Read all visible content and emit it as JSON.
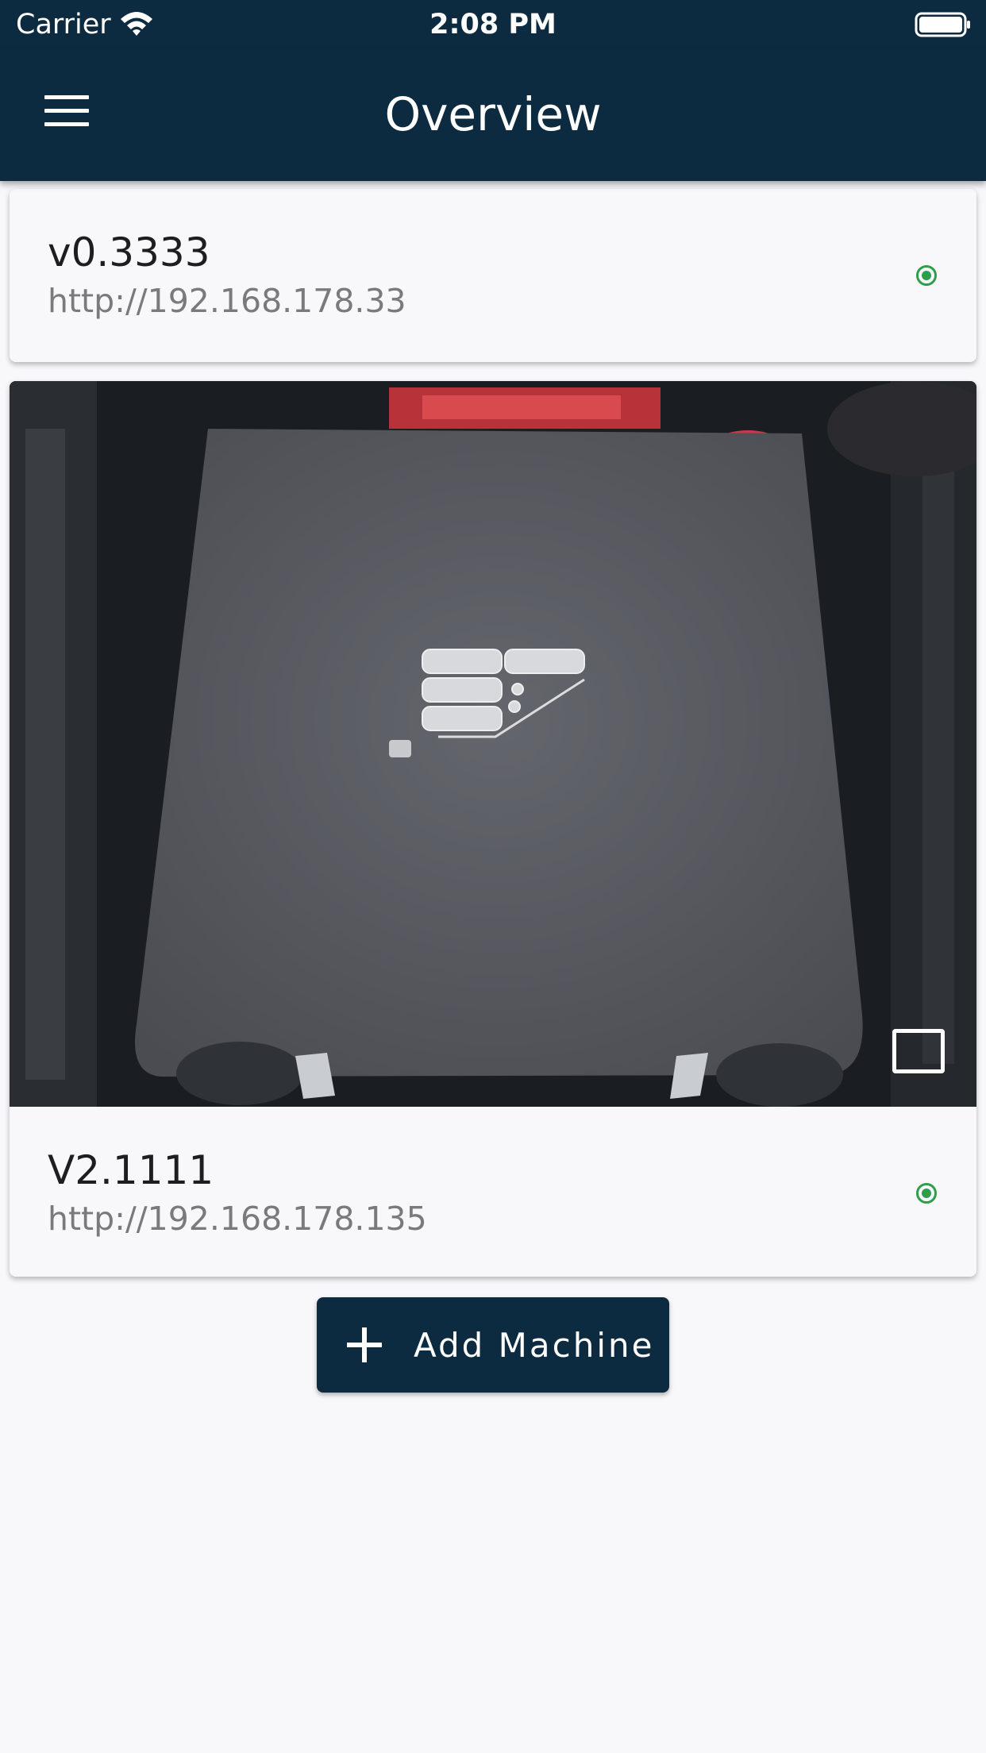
{
  "status_bar": {
    "carrier": "Carrier",
    "time": "2:08 PM"
  },
  "header": {
    "title": "Overview"
  },
  "machines": [
    {
      "name": "v0.3333",
      "url": "http://192.168.178.33",
      "status_color": "#2e9e4a"
    },
    {
      "name": "V2.1111",
      "url": "http://192.168.178.135",
      "status_color": "#2e9e4a"
    }
  ],
  "add_machine": {
    "label": "Add Machine"
  },
  "colors": {
    "primary": "#0d2b40",
    "background": "#f8f8fb",
    "online": "#2e9e4a"
  },
  "icons": {
    "menu": "menu-icon",
    "status": "status-dot-icon",
    "fullscreen": "fullscreen-icon",
    "add": "plus-icon",
    "wifi": "wifi-icon",
    "battery": "battery-icon"
  }
}
